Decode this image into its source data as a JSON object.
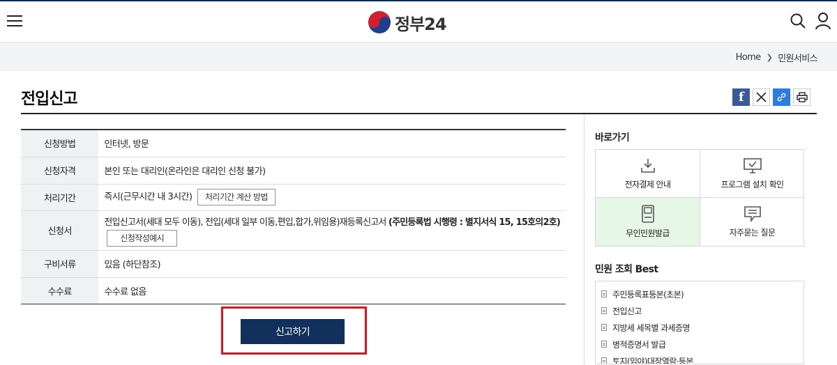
{
  "header": {
    "logo_text": "정부24"
  },
  "breadcrumb": {
    "home": "Home",
    "current": "민원서비스"
  },
  "page": {
    "title": "전입신고"
  },
  "info_table": {
    "rows": [
      {
        "label": "신청방법",
        "value": "인터넷, 방문"
      },
      {
        "label": "신청자격",
        "value": "본인 또는 대리인(온라인은 대리인 신청 불가)"
      },
      {
        "label": "처리기간",
        "value": "즉시(근무시간 내 3시간)",
        "button": "처리기간 계산 방법"
      },
      {
        "label": "신청서",
        "value": "전입신고서(세대 모두 이동), 전입(세대 일부 이동,편입,합가,위임용)재등록신고서 ",
        "value_bold": "(주민등록법 시행령 : 별지서식 15, 15호의2호)",
        "button": "신청작성예시"
      },
      {
        "label": "구비서류",
        "value": "있음 (하단참조)"
      },
      {
        "label": "수수료",
        "value": "수수료 없음"
      }
    ]
  },
  "apply_button": "신고하기",
  "sidebar": {
    "quick_title": "바로가기",
    "quick_links": [
      {
        "label": "전자결제 안내",
        "icon": "download-icon"
      },
      {
        "label": "프로그램 설치 확인",
        "icon": "monitor-check-icon"
      },
      {
        "label": "무인민원발급",
        "icon": "kiosk-icon"
      },
      {
        "label": "자주묻는 질문",
        "icon": "speech-bubble-icon"
      }
    ],
    "best_title": "민원 조회 Best",
    "best_items": [
      "주민등록표등본(초본)",
      "전입신고",
      "지방세 세목별 과세증명",
      "병적증명서 발급",
      "토지(임야)대장열람·등본"
    ]
  },
  "colors": {
    "brand_navy": "#11315c",
    "highlight_red": "#e3141b",
    "kiosk_active_bg": "#e6f7e6"
  }
}
